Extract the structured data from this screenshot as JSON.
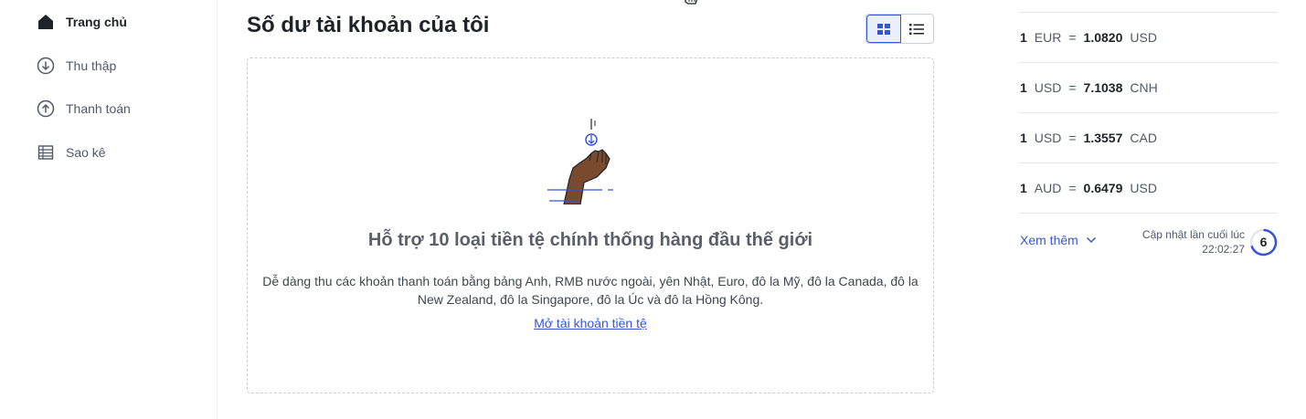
{
  "sidebar": {
    "items": [
      {
        "label": "Trang chủ",
        "icon": "home-icon",
        "active": true
      },
      {
        "label": "Thu thập",
        "icon": "arrow-down-circle-icon",
        "active": false
      },
      {
        "label": "Thanh toán",
        "icon": "arrow-up-circle-icon",
        "active": false
      },
      {
        "label": "Sao kê",
        "icon": "table-icon",
        "active": false
      }
    ]
  },
  "main": {
    "title": "Số dư tài khoản của tôi",
    "empty": {
      "heading": "Hỗ trợ 10 loại tiền tệ chính thống hàng đầu thế giới",
      "desc_line1": "Dễ dàng thu các khoản thanh toán bằng bảng Anh, RMB nước ngoài, yên Nhật, Euro, đô la Mỹ, đô la Canada, đô la",
      "desc_line2": "New Zealand, đô la Singapore, đô la Úc và đô la Hồng Kông.",
      "link": "Mở tài khoản tiền tệ"
    }
  },
  "rates": {
    "rows": [
      {
        "base_amount": "1",
        "base": "EUR",
        "eq": "=",
        "value": "1.0820",
        "quote": "USD"
      },
      {
        "base_amount": "1",
        "base": "USD",
        "eq": "=",
        "value": "7.1038",
        "quote": "CNH"
      },
      {
        "base_amount": "1",
        "base": "USD",
        "eq": "=",
        "value": "1.3557",
        "quote": "CAD"
      },
      {
        "base_amount": "1",
        "base": "AUD",
        "eq": "=",
        "value": "0.6479",
        "quote": "USD"
      }
    ],
    "more_label": "Xem thêm",
    "updated_label": "Cập nhật lần cuối lúc",
    "updated_time": "22:02:27",
    "countdown": "6",
    "countdown_progress": 0.7
  },
  "colors": {
    "accent": "#3555d6",
    "hand": "#7a4a2e"
  }
}
